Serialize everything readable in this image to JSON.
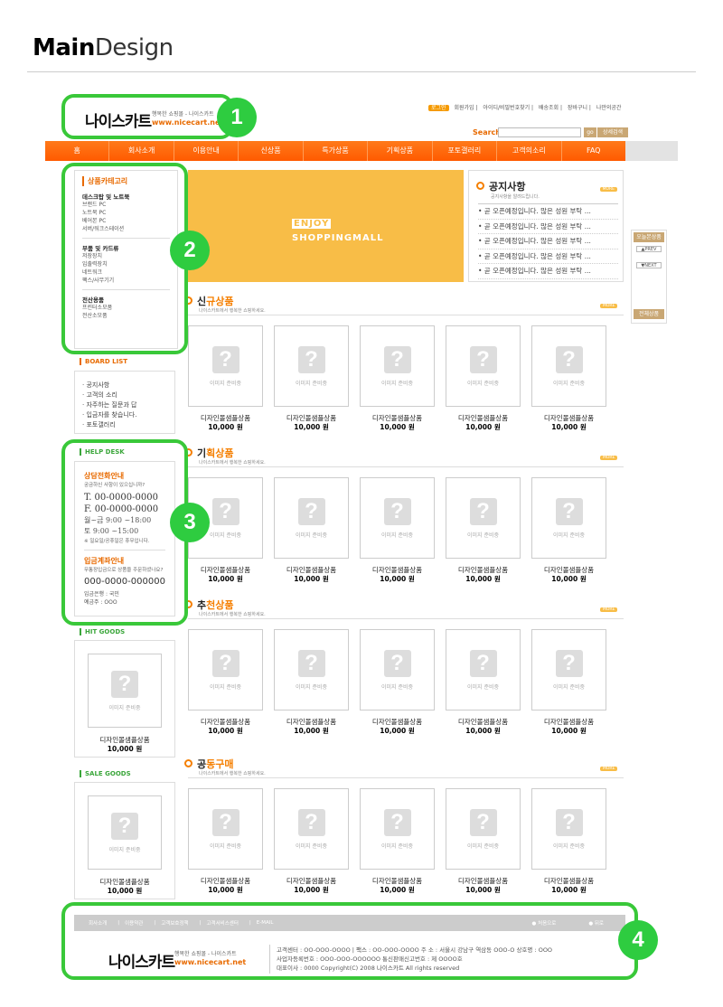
{
  "heading": {
    "bold": "Main",
    "rest": "Design"
  },
  "logo": {
    "main": "나이스카트",
    "tagline": "행복한 쇼핑몰 - 나이스카트",
    "url": "www.nicecart.net"
  },
  "toplinks": [
    "로그인",
    "회원가입",
    "아이디/비밀번호찾기",
    "배송조회",
    "장바구니",
    "나만의공간"
  ],
  "search": {
    "label": "Search",
    "go": "go",
    "advanced": "상세검색"
  },
  "nav": [
    "홈",
    "회사소개",
    "이용안내",
    "신상품",
    "특가상품",
    "기획상품",
    "포토갤러리",
    "고객의소리",
    "FAQ"
  ],
  "category": {
    "title": "상품카테고리",
    "groups": [
      {
        "name": "데스크탑 및 노트북",
        "items": [
          "브랜드 PC",
          "노트북 PC",
          "베어본 PC",
          "서버/워크스테이션"
        ]
      },
      {
        "name": "부품 및 카드류",
        "items": [
          "저장장치",
          "입출력장치",
          "네트워크",
          "팩스/사무기기"
        ]
      },
      {
        "name": "전산용품",
        "items": [
          "프린터소모품",
          "전산소모품"
        ]
      }
    ]
  },
  "board": {
    "title": "BOARD LIST",
    "items": [
      "· 공지사항",
      "· 고객의 소리",
      "· 자주하는 질문과 답",
      "· 입금자를 찾습니다.",
      "· 포토갤러리"
    ]
  },
  "helpdesk": {
    "title": "HELP DESK",
    "tel_title": "상담전화안내",
    "tel_sub": "궁금하신 사항이 있으십니까?",
    "tel": "T. 00-0000-0000",
    "fax": "F. 00-0000-0000",
    "hours1": "월~금 9:00 ~18:00",
    "hours2": "토 9:00 ~15:00",
    "holiday": "※ 일요일/공휴일은 휴무입니다.",
    "bank_title": "입금계좌안내",
    "bank_sub": "무통장입금으로 상품을 주문하셨나요?",
    "account": "000-0000-000000",
    "bank": "입금은행 : 국민",
    "holder": "예금주 : OOO"
  },
  "hit": {
    "title": "HIT GOODS"
  },
  "sale": {
    "title": "SALE GOODS"
  },
  "product": {
    "placeholder": "이미지 준비중",
    "name": "디자인몰샘플상품",
    "price": "10,000 원",
    "q": "?"
  },
  "banner": {
    "line1": "ENJOY",
    "line2": "SHOPPINGMALL"
  },
  "notice": {
    "title": "공지사항",
    "sub": "공지사항을 알려드립니다.",
    "more": "MORE",
    "items": [
      "• 곧 오픈예정입니다. 많은 성원 부탁 ...",
      "• 곧 오픈예정입니다. 많은 성원 부탁 ...",
      "• 곧 오픈예정입니다. 많은 성원 부탁 ...",
      "• 곧 오픈예정입니다. 많은 성원 부탁 ...",
      "• 곧 오픈예정입니다. 많은 성원 부탁 ..."
    ]
  },
  "today": {
    "title": "오늘본상품",
    "prev": "▲PREV",
    "next": "▼NEXT",
    "all": "전체상품"
  },
  "sections": [
    {
      "a": "신",
      "b": "규상품",
      "sub": "나이스카트에서 행복한 쇼핑하세요."
    },
    {
      "a": "기",
      "b": "획상품",
      "sub": "나이스카트에서 행복한 쇼핑하세요."
    },
    {
      "a": "추",
      "b": "천상품",
      "sub": "나이스카트에서 행복한 쇼핑하세요."
    },
    {
      "a": "공",
      "b": "동구매",
      "sub": "나이스카트에서 행복한 쇼핑하세요."
    }
  ],
  "footer": {
    "links": [
      "회사소개",
      "이용약관",
      "고객보호정책",
      "고객서비스센터",
      "E-MAIL"
    ],
    "top": "처음으로",
    "back": "뒤로",
    "line1": "고객센터 : OO-OOO-OOOO  |  팩스 : OO-OOO-OOOO      주 소 : 서울시 강남구 역삼동 OOO-O    상호명 : OOO",
    "line2": "사업자등록번호 : OOO-OOO-OOOOOO      통신판매신고번호 : 제 OOOO호",
    "line3": "대표이사 : 0000 Copyright(C) 2008 나이스카트 All rights reserved"
  },
  "callouts": [
    "1",
    "2",
    "3",
    "4"
  ],
  "colors": {
    "accent": "#ff6600",
    "callout": "#39c839"
  }
}
